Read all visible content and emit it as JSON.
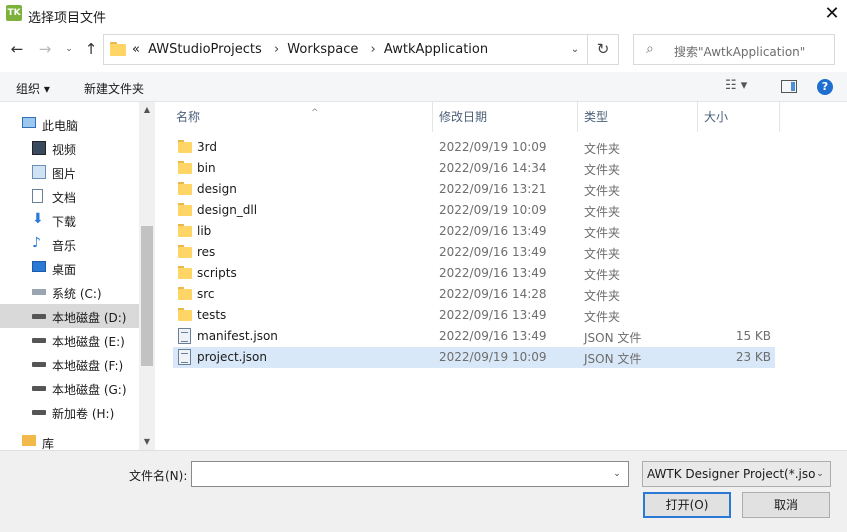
{
  "window": {
    "icon_text": "TK",
    "title": "选择项目文件",
    "close_glyph": "✕"
  },
  "nav_buttons": {
    "back": "←",
    "forward": "→",
    "recent": "⌄",
    "up": "↑"
  },
  "address": {
    "chevron": "«",
    "crumbs": [
      "AWStudioProjects",
      "Workspace",
      "AwtkApplication"
    ],
    "separator": "›",
    "dropdown": "⌄",
    "refresh": "↻"
  },
  "search": {
    "icon": "⌕",
    "placeholder": "搜索\"AwtkApplication\""
  },
  "toolbar": {
    "organize": "组织 ▾",
    "new_folder": "新建文件夹",
    "view": "☷ ▾",
    "help": "?"
  },
  "navpane": {
    "items": [
      {
        "label": "此电脑",
        "icon": "computer-icon"
      },
      {
        "label": "视频",
        "icon": "video-icon"
      },
      {
        "label": "图片",
        "icon": "pictures-icon"
      },
      {
        "label": "文档",
        "icon": "documents-icon"
      },
      {
        "label": "下载",
        "icon": "download-icon"
      },
      {
        "label": "音乐",
        "icon": "music-icon"
      },
      {
        "label": "桌面",
        "icon": "desktop-icon"
      },
      {
        "label": "系统 (C:)",
        "icon": "system-drive-icon"
      },
      {
        "label": "本地磁盘 (D:)",
        "icon": "drive-icon"
      },
      {
        "label": "本地磁盘 (E:)",
        "icon": "drive-icon"
      },
      {
        "label": "本地磁盘 (F:)",
        "icon": "drive-icon"
      },
      {
        "label": "本地磁盘 (G:)",
        "icon": "drive-icon"
      },
      {
        "label": "新加卷 (H:)",
        "icon": "drive-icon"
      },
      {
        "label": "库",
        "icon": "library-icon"
      }
    ],
    "selected_index": 8
  },
  "columns": {
    "name": "名称",
    "date": "修改日期",
    "type": "类型",
    "size": "大小",
    "sort_caret": "^"
  },
  "files": [
    {
      "name": "3rd",
      "date": "2022/09/19 10:09",
      "type": "文件夹",
      "size": "",
      "kind": "folder"
    },
    {
      "name": "bin",
      "date": "2022/09/16 14:34",
      "type": "文件夹",
      "size": "",
      "kind": "folder"
    },
    {
      "name": "design",
      "date": "2022/09/16 13:21",
      "type": "文件夹",
      "size": "",
      "kind": "folder"
    },
    {
      "name": "design_dll",
      "date": "2022/09/19 10:09",
      "type": "文件夹",
      "size": "",
      "kind": "folder"
    },
    {
      "name": "lib",
      "date": "2022/09/16 13:49",
      "type": "文件夹",
      "size": "",
      "kind": "folder"
    },
    {
      "name": "res",
      "date": "2022/09/16 13:49",
      "type": "文件夹",
      "size": "",
      "kind": "folder"
    },
    {
      "name": "scripts",
      "date": "2022/09/16 13:49",
      "type": "文件夹",
      "size": "",
      "kind": "folder"
    },
    {
      "name": "src",
      "date": "2022/09/16 14:28",
      "type": "文件夹",
      "size": "",
      "kind": "folder"
    },
    {
      "name": "tests",
      "date": "2022/09/16 13:49",
      "type": "文件夹",
      "size": "",
      "kind": "folder"
    },
    {
      "name": "manifest.json",
      "date": "2022/09/16 13:49",
      "type": "JSON 文件",
      "size": "15 KB",
      "kind": "file"
    },
    {
      "name": "project.json",
      "date": "2022/09/19 10:09",
      "type": "JSON 文件",
      "size": "23 KB",
      "kind": "file"
    }
  ],
  "selected_file_index": 10,
  "bottom": {
    "filename_label": "文件名(N):",
    "filename_value": "",
    "dropdown": "⌄",
    "filter": "AWTK Designer Project(*.json)",
    "open": "打开(O)",
    "cancel": "取消"
  },
  "scroll": {
    "up": "▲",
    "down": "▼"
  },
  "colors": {
    "accent": "#2a79d5",
    "selection": "#d9e8f8",
    "folder": "#ffd665",
    "app_icon": "#7cb23a"
  }
}
